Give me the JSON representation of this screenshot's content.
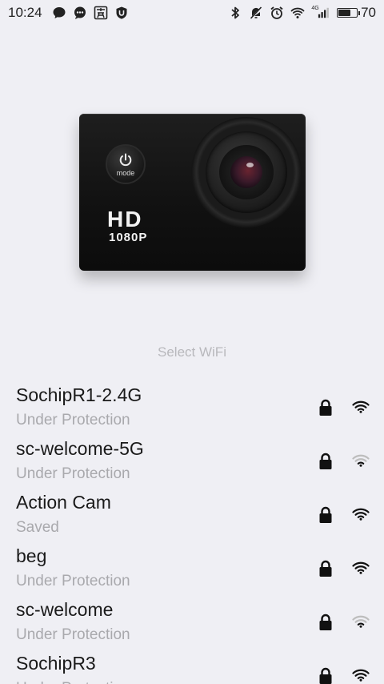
{
  "status_bar": {
    "time": "10:24",
    "network_tag": "4G",
    "battery_level": "70",
    "battery_fraction": 0.7,
    "left_icons": [
      "chat-bubble-icon",
      "messenger-icon",
      "app-notification-icon",
      "shield-icon"
    ],
    "right_icons": [
      "bluetooth-icon",
      "mute-icon",
      "alarm-icon",
      "wifi-status-icon",
      "cell-signal-icon",
      "battery-icon"
    ]
  },
  "camera": {
    "power_label": "mode",
    "hd_text": "HD",
    "resolution_text": "1080P"
  },
  "select_wifi": {
    "title": "Select WiFi"
  },
  "networks": [
    {
      "ssid": "SochipR1-2.4G",
      "status": "Under Protection",
      "locked": true,
      "signal": "strong"
    },
    {
      "ssid": "sc-welcome-5G",
      "status": "Under Protection",
      "locked": true,
      "signal": "weak"
    },
    {
      "ssid": "Action Cam",
      "status": "Saved",
      "locked": true,
      "signal": "strong"
    },
    {
      "ssid": "beg",
      "status": "Under Protection",
      "locked": true,
      "signal": "strong"
    },
    {
      "ssid": "sc-welcome",
      "status": "Under Protection",
      "locked": true,
      "signal": "weak"
    },
    {
      "ssid": "SochipR3",
      "status": "Under Protection",
      "locked": true,
      "signal": "strong"
    }
  ],
  "colors": {
    "background": "#efeff4",
    "primary_text": "#1a1a1a",
    "secondary_text": "#a9a9ad",
    "title_text": "#b8b8bc"
  }
}
